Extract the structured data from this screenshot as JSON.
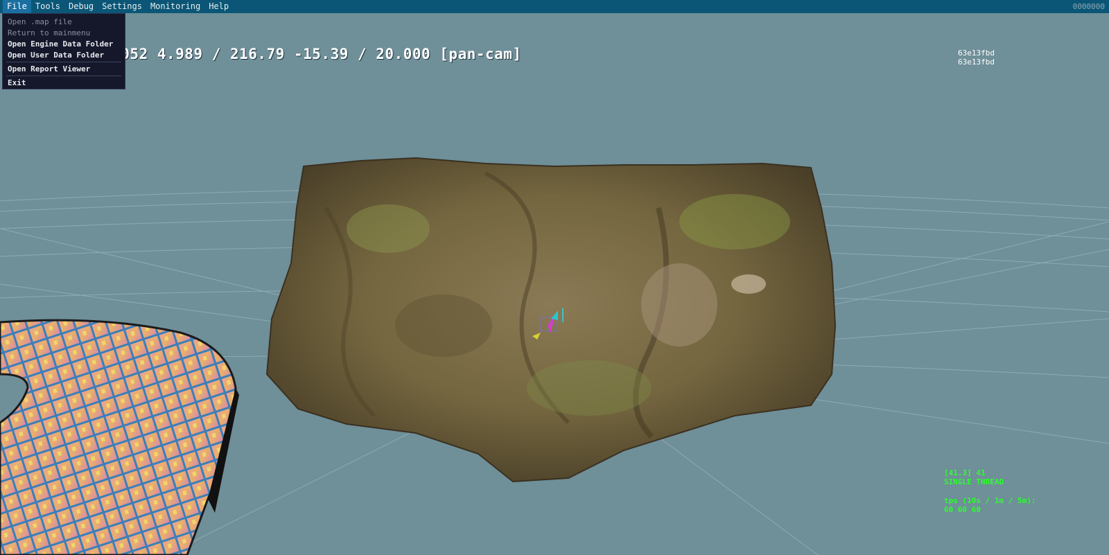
{
  "menubar": {
    "items": [
      "File",
      "Tools",
      "Debug",
      "Settings",
      "Monitoring",
      "Help"
    ],
    "fps_counter": "0000000"
  },
  "file_menu": {
    "items": [
      {
        "label": "Open .map file",
        "enabled": false
      },
      {
        "label": "Return to mainmenu",
        "enabled": false
      },
      {
        "label": "Open Engine Data Folder",
        "enabled": true
      },
      {
        "label": "Open User Data Folder",
        "enabled": true
      },
      {
        "label": "Open Report Viewer",
        "enabled": true
      },
      {
        "label": "Exit",
        "enabled": true
      }
    ]
  },
  "hud": {
    "camera_readout": "7.052 4.989 / 216.79 -15.39 / 20.000 [pan-cam]",
    "hash_lines": [
      "63e13fbd",
      "63e13fbd"
    ],
    "stats_lines": [
      "[41.3] 41",
      "SINGLE THREAD",
      "",
      "tps (10s / 1m / 5m):",
      "60 60 60"
    ]
  },
  "colors": {
    "menubar": "#0b5676",
    "sky": "#6f8f99",
    "stats_text": "#2bff2b",
    "rock_base": "#7d6a48"
  }
}
